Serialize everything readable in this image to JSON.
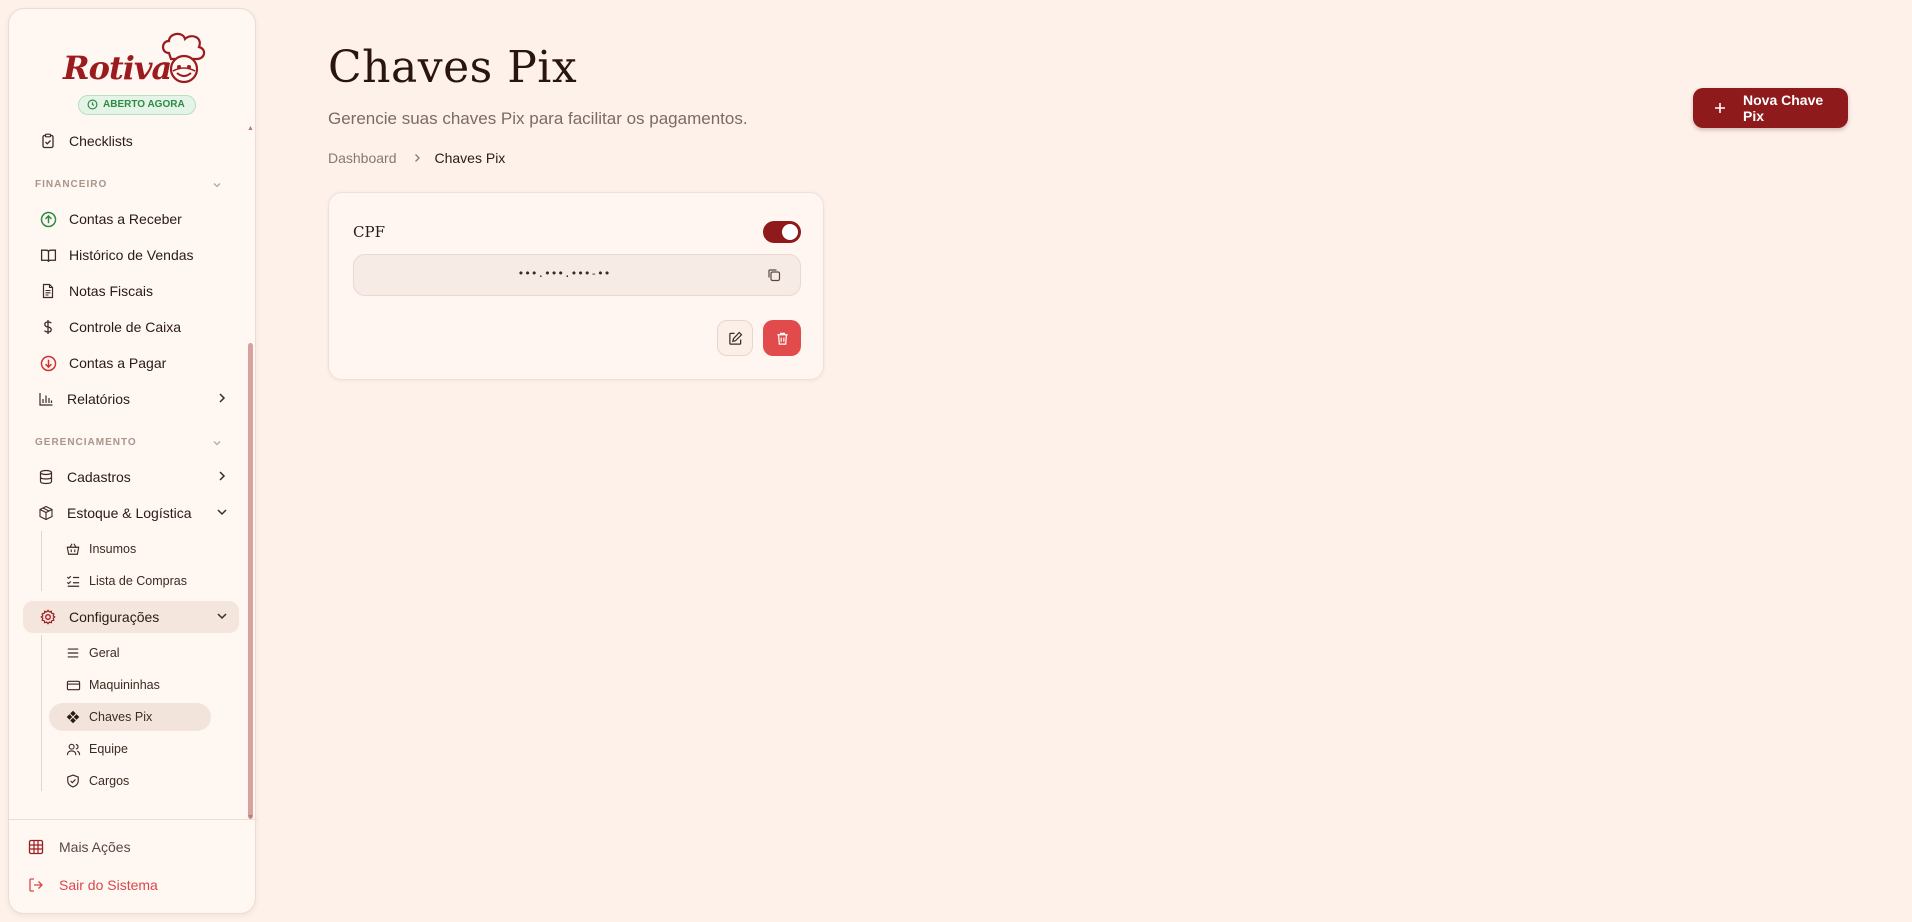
{
  "brand": {
    "name": "Rotiva",
    "status": "ABERTO AGORA"
  },
  "sidebar": {
    "checklists": "Checklists",
    "sections": {
      "financeiro": "FINANCEIRO",
      "gerenciamento": "GERENCIAMENTO"
    },
    "financeiro_items": [
      {
        "label": "Contas a Receber",
        "icon": "arrow-up-circle-icon"
      },
      {
        "label": "Histórico de Vendas",
        "icon": "book-open-icon"
      },
      {
        "label": "Notas Fiscais",
        "icon": "file-text-icon"
      },
      {
        "label": "Controle de Caixa",
        "icon": "dollar-icon"
      },
      {
        "label": "Contas a Pagar",
        "icon": "arrow-down-circle-icon"
      },
      {
        "label": "Relatórios",
        "icon": "bar-chart-icon"
      }
    ],
    "cadastros": "Cadastros",
    "estoque": "Estoque & Logística",
    "estoque_sub": [
      "Insumos",
      "Lista de Compras"
    ],
    "configuracoes": "Configurações",
    "config_sub": [
      "Geral",
      "Maquininhas",
      "Chaves Pix",
      "Equipe",
      "Cargos"
    ],
    "mais_acoes": "Mais Ações",
    "sair": "Sair do Sistema"
  },
  "page": {
    "title": "Chaves Pix",
    "subtitle": "Gerencie suas chaves Pix para facilitar os pagamentos.",
    "breadcrumb": {
      "parent": "Dashboard",
      "current": "Chaves Pix"
    },
    "new_button": "Nova Chave Pix"
  },
  "pix_keys": [
    {
      "type": "CPF",
      "value": "•••.•••.•••-••",
      "enabled": true
    }
  ],
  "colors": {
    "accent": "#8e1a1c",
    "danger": "#e14b4b",
    "success": "#2f8a46",
    "background": "#fdf1ea"
  }
}
